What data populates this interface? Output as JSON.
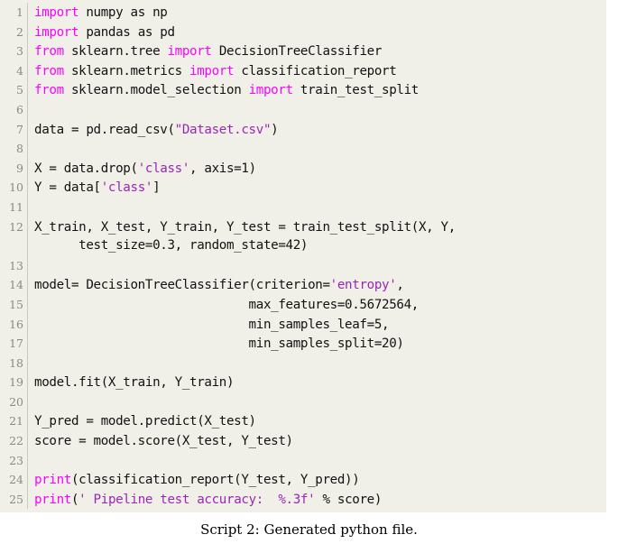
{
  "figure": {
    "caption": "Script 2: Generated python file.",
    "background_color": "#ffffff",
    "listing_background_color": "#f0f0e8",
    "keyword_color": "#ff00ff",
    "string_color": "#9b26b6",
    "text_color": "#121212",
    "lineno_color": "#8a8a85",
    "language": "python"
  },
  "code": {
    "lines": [
      {
        "number": "1",
        "text": "import numpy as np",
        "tokens": [
          {
            "t": "import",
            "c": "kw"
          },
          {
            "t": " numpy as np",
            "c": ""
          }
        ]
      },
      {
        "number": "2",
        "text": "import pandas as pd",
        "tokens": [
          {
            "t": "import",
            "c": "kw"
          },
          {
            "t": " pandas as pd",
            "c": ""
          }
        ]
      },
      {
        "number": "3",
        "text": "from sklearn.tree import DecisionTreeClassifier",
        "tokens": [
          {
            "t": "from",
            "c": "kw"
          },
          {
            "t": " sklearn.tree ",
            "c": ""
          },
          {
            "t": "import",
            "c": "kw"
          },
          {
            "t": " DecisionTreeClassifier",
            "c": ""
          }
        ]
      },
      {
        "number": "4",
        "text": "from sklearn.metrics import classification_report",
        "tokens": [
          {
            "t": "from",
            "c": "kw"
          },
          {
            "t": " sklearn.metrics ",
            "c": ""
          },
          {
            "t": "import",
            "c": "kw"
          },
          {
            "t": " classification_report",
            "c": ""
          }
        ]
      },
      {
        "number": "5",
        "text": "from sklearn.model_selection import train_test_split",
        "tokens": [
          {
            "t": "from",
            "c": "kw"
          },
          {
            "t": " sklearn.model_selection ",
            "c": ""
          },
          {
            "t": "import",
            "c": "kw"
          },
          {
            "t": " train_test_split",
            "c": ""
          }
        ]
      },
      {
        "number": "6",
        "text": "",
        "tokens": []
      },
      {
        "number": "7",
        "text": "data = pd.read_csv(\"Dataset.csv\")",
        "tokens": [
          {
            "t": "data = pd.read_csv(",
            "c": ""
          },
          {
            "t": "\"Dataset.csv\"",
            "c": "str"
          },
          {
            "t": ")",
            "c": ""
          }
        ]
      },
      {
        "number": "8",
        "text": "",
        "tokens": []
      },
      {
        "number": "9",
        "text": "X = data.drop('class', axis=1)",
        "tokens": [
          {
            "t": "X = data.drop(",
            "c": ""
          },
          {
            "t": "'class'",
            "c": "str"
          },
          {
            "t": ", axis=1)",
            "c": ""
          }
        ]
      },
      {
        "number": "10",
        "text": "Y = data['class']",
        "tokens": [
          {
            "t": "Y = data[",
            "c": ""
          },
          {
            "t": "'class'",
            "c": "str"
          },
          {
            "t": "]",
            "c": ""
          }
        ]
      },
      {
        "number": "11",
        "text": "",
        "tokens": []
      },
      {
        "number": "12",
        "text": "X_train, X_test, Y_train, Y_test = train_test_split(X, Y,",
        "tokens": [
          {
            "t": "X_train, X_test, Y_train, Y_test = train_test_split(X, Y,",
            "c": ""
          }
        ]
      },
      {
        "number": "",
        "text": "      test_size=0.3, random_state=42)",
        "tokens": [
          {
            "t": "      test_size=0.3, random_state=42)",
            "c": ""
          }
        ]
      },
      {
        "number": "13",
        "text": "",
        "tokens": []
      },
      {
        "number": "14",
        "text": "model= DecisionTreeClassifier(criterion='entropy',",
        "tokens": [
          {
            "t": "model= DecisionTreeClassifier(criterion=",
            "c": ""
          },
          {
            "t": "'entropy'",
            "c": "str"
          },
          {
            "t": ",",
            "c": ""
          }
        ]
      },
      {
        "number": "15",
        "text": "                             max_features=0.5672564,",
        "tokens": [
          {
            "t": "                             max_features=0.5672564,",
            "c": ""
          }
        ]
      },
      {
        "number": "16",
        "text": "                             min_samples_leaf=5,",
        "tokens": [
          {
            "t": "                             min_samples_leaf=5,",
            "c": ""
          }
        ]
      },
      {
        "number": "17",
        "text": "                             min_samples_split=20)",
        "tokens": [
          {
            "t": "                             min_samples_split=20)",
            "c": ""
          }
        ]
      },
      {
        "number": "18",
        "text": "",
        "tokens": []
      },
      {
        "number": "19",
        "text": "model.fit(X_train, Y_train)",
        "tokens": [
          {
            "t": "model.fit(X_train, Y_train)",
            "c": ""
          }
        ]
      },
      {
        "number": "20",
        "text": "",
        "tokens": []
      },
      {
        "number": "21",
        "text": "Y_pred = model.predict(X_test)",
        "tokens": [
          {
            "t": "Y_pred = model.predict(X_test)",
            "c": ""
          }
        ]
      },
      {
        "number": "22",
        "text": "score = model.score(X_test, Y_test)",
        "tokens": [
          {
            "t": "score = model.score(X_test, Y_test)",
            "c": ""
          }
        ]
      },
      {
        "number": "23",
        "text": "",
        "tokens": []
      },
      {
        "number": "24",
        "text": "print(classification_report(Y_test, Y_pred))",
        "tokens": [
          {
            "t": "print",
            "c": "kw"
          },
          {
            "t": "(classification_report(Y_test, Y_pred))",
            "c": ""
          }
        ]
      },
      {
        "number": "25",
        "text": "print(' Pipeline test accuracy:  %.3f' % score)",
        "tokens": [
          {
            "t": "print",
            "c": "kw"
          },
          {
            "t": "(",
            "c": ""
          },
          {
            "t": "' Pipeline test accuracy:  %.3f'",
            "c": "str"
          },
          {
            "t": " % score)",
            "c": ""
          }
        ]
      }
    ]
  }
}
